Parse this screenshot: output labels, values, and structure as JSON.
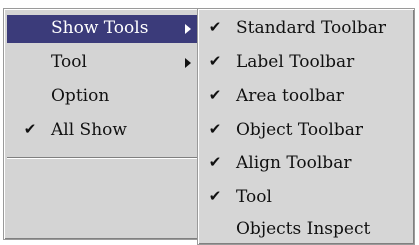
{
  "main_menu": {
    "items": [
      {
        "label": "Show Tools",
        "checked": false,
        "submenu": true,
        "selected": true
      },
      {
        "label": "Tool",
        "checked": false,
        "submenu": true,
        "selected": false
      },
      {
        "label": "Option",
        "checked": false,
        "submenu": false,
        "selected": false
      },
      {
        "label": "All Show",
        "checked": true,
        "submenu": false,
        "selected": false
      }
    ]
  },
  "submenu": {
    "items": [
      {
        "label": "Standard Toolbar",
        "checked": true
      },
      {
        "label": "Label Toolbar",
        "checked": true
      },
      {
        "label": "Area toolbar",
        "checked": true
      },
      {
        "label": "Object Toolbar",
        "checked": true
      },
      {
        "label": "Align Toolbar",
        "checked": true
      },
      {
        "label": "Tool",
        "checked": true
      },
      {
        "label": "Objects Inspect",
        "checked": false
      }
    ]
  },
  "icons": {
    "check": "checkmark-icon",
    "submenu_arrow": "submenu-arrow-icon"
  },
  "colors": {
    "menu_bg": "#d4d4d4",
    "selected_bg": "#3b3b7a",
    "selected_text": "#ffffff",
    "text": "#111111"
  }
}
